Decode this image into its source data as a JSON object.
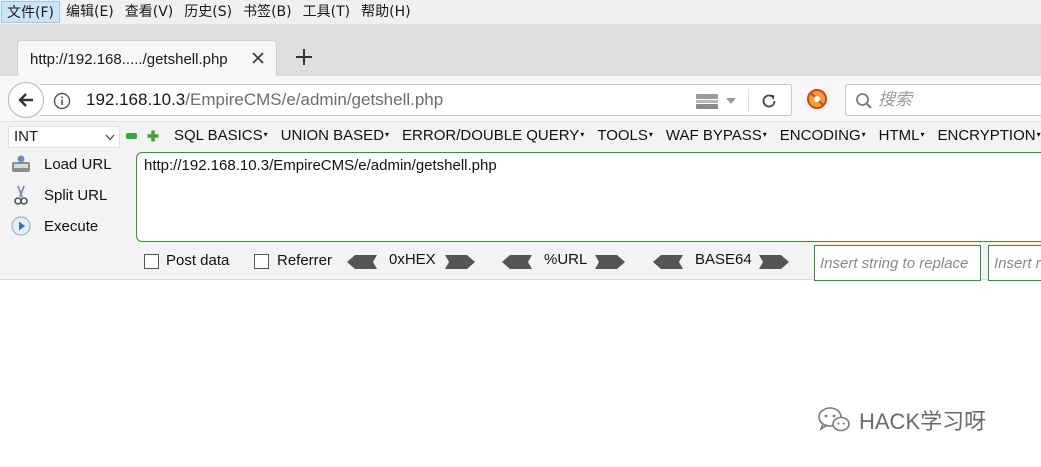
{
  "menubar": {
    "items": [
      "文件(F)",
      "编辑(E)",
      "查看(V)",
      "历史(S)",
      "书签(B)",
      "工具(T)",
      "帮助(H)"
    ]
  },
  "tab": {
    "title": "http://192.168...../getshell.php"
  },
  "navbar": {
    "url_host": "192.168.10.3",
    "url_path": "/EmpireCMS/e/admin/getshell.php",
    "search_placeholder": "搜索"
  },
  "hackbar": {
    "type_select": "INT",
    "menus": [
      "SQL BASICS",
      "UNION BASED",
      "ERROR/DOUBLE QUERY",
      "TOOLS",
      "WAF BYPASS",
      "ENCODING",
      "HTML",
      "ENCRYPTION"
    ],
    "load_url": "Load URL",
    "split_url": "Split URL",
    "execute": "Execute",
    "url_value": "http://192.168.10.3/EmpireCMS/e/admin/getshell.php",
    "post_data": "Post data",
    "referrer": "Referrer",
    "hex": "0xHEX",
    "url_encode": "%URL",
    "base64": "BASE64",
    "replace_placeholder": "Insert string to replace",
    "replace_with_placeholder": "Insert replacing string"
  },
  "watermark": {
    "text": "HACK学习呀"
  },
  "colors": {
    "menubar_bg": "#f0f0f0",
    "tabstrip_bg": "#dfdfdf",
    "hackbar_border": "#3c8d3c"
  }
}
